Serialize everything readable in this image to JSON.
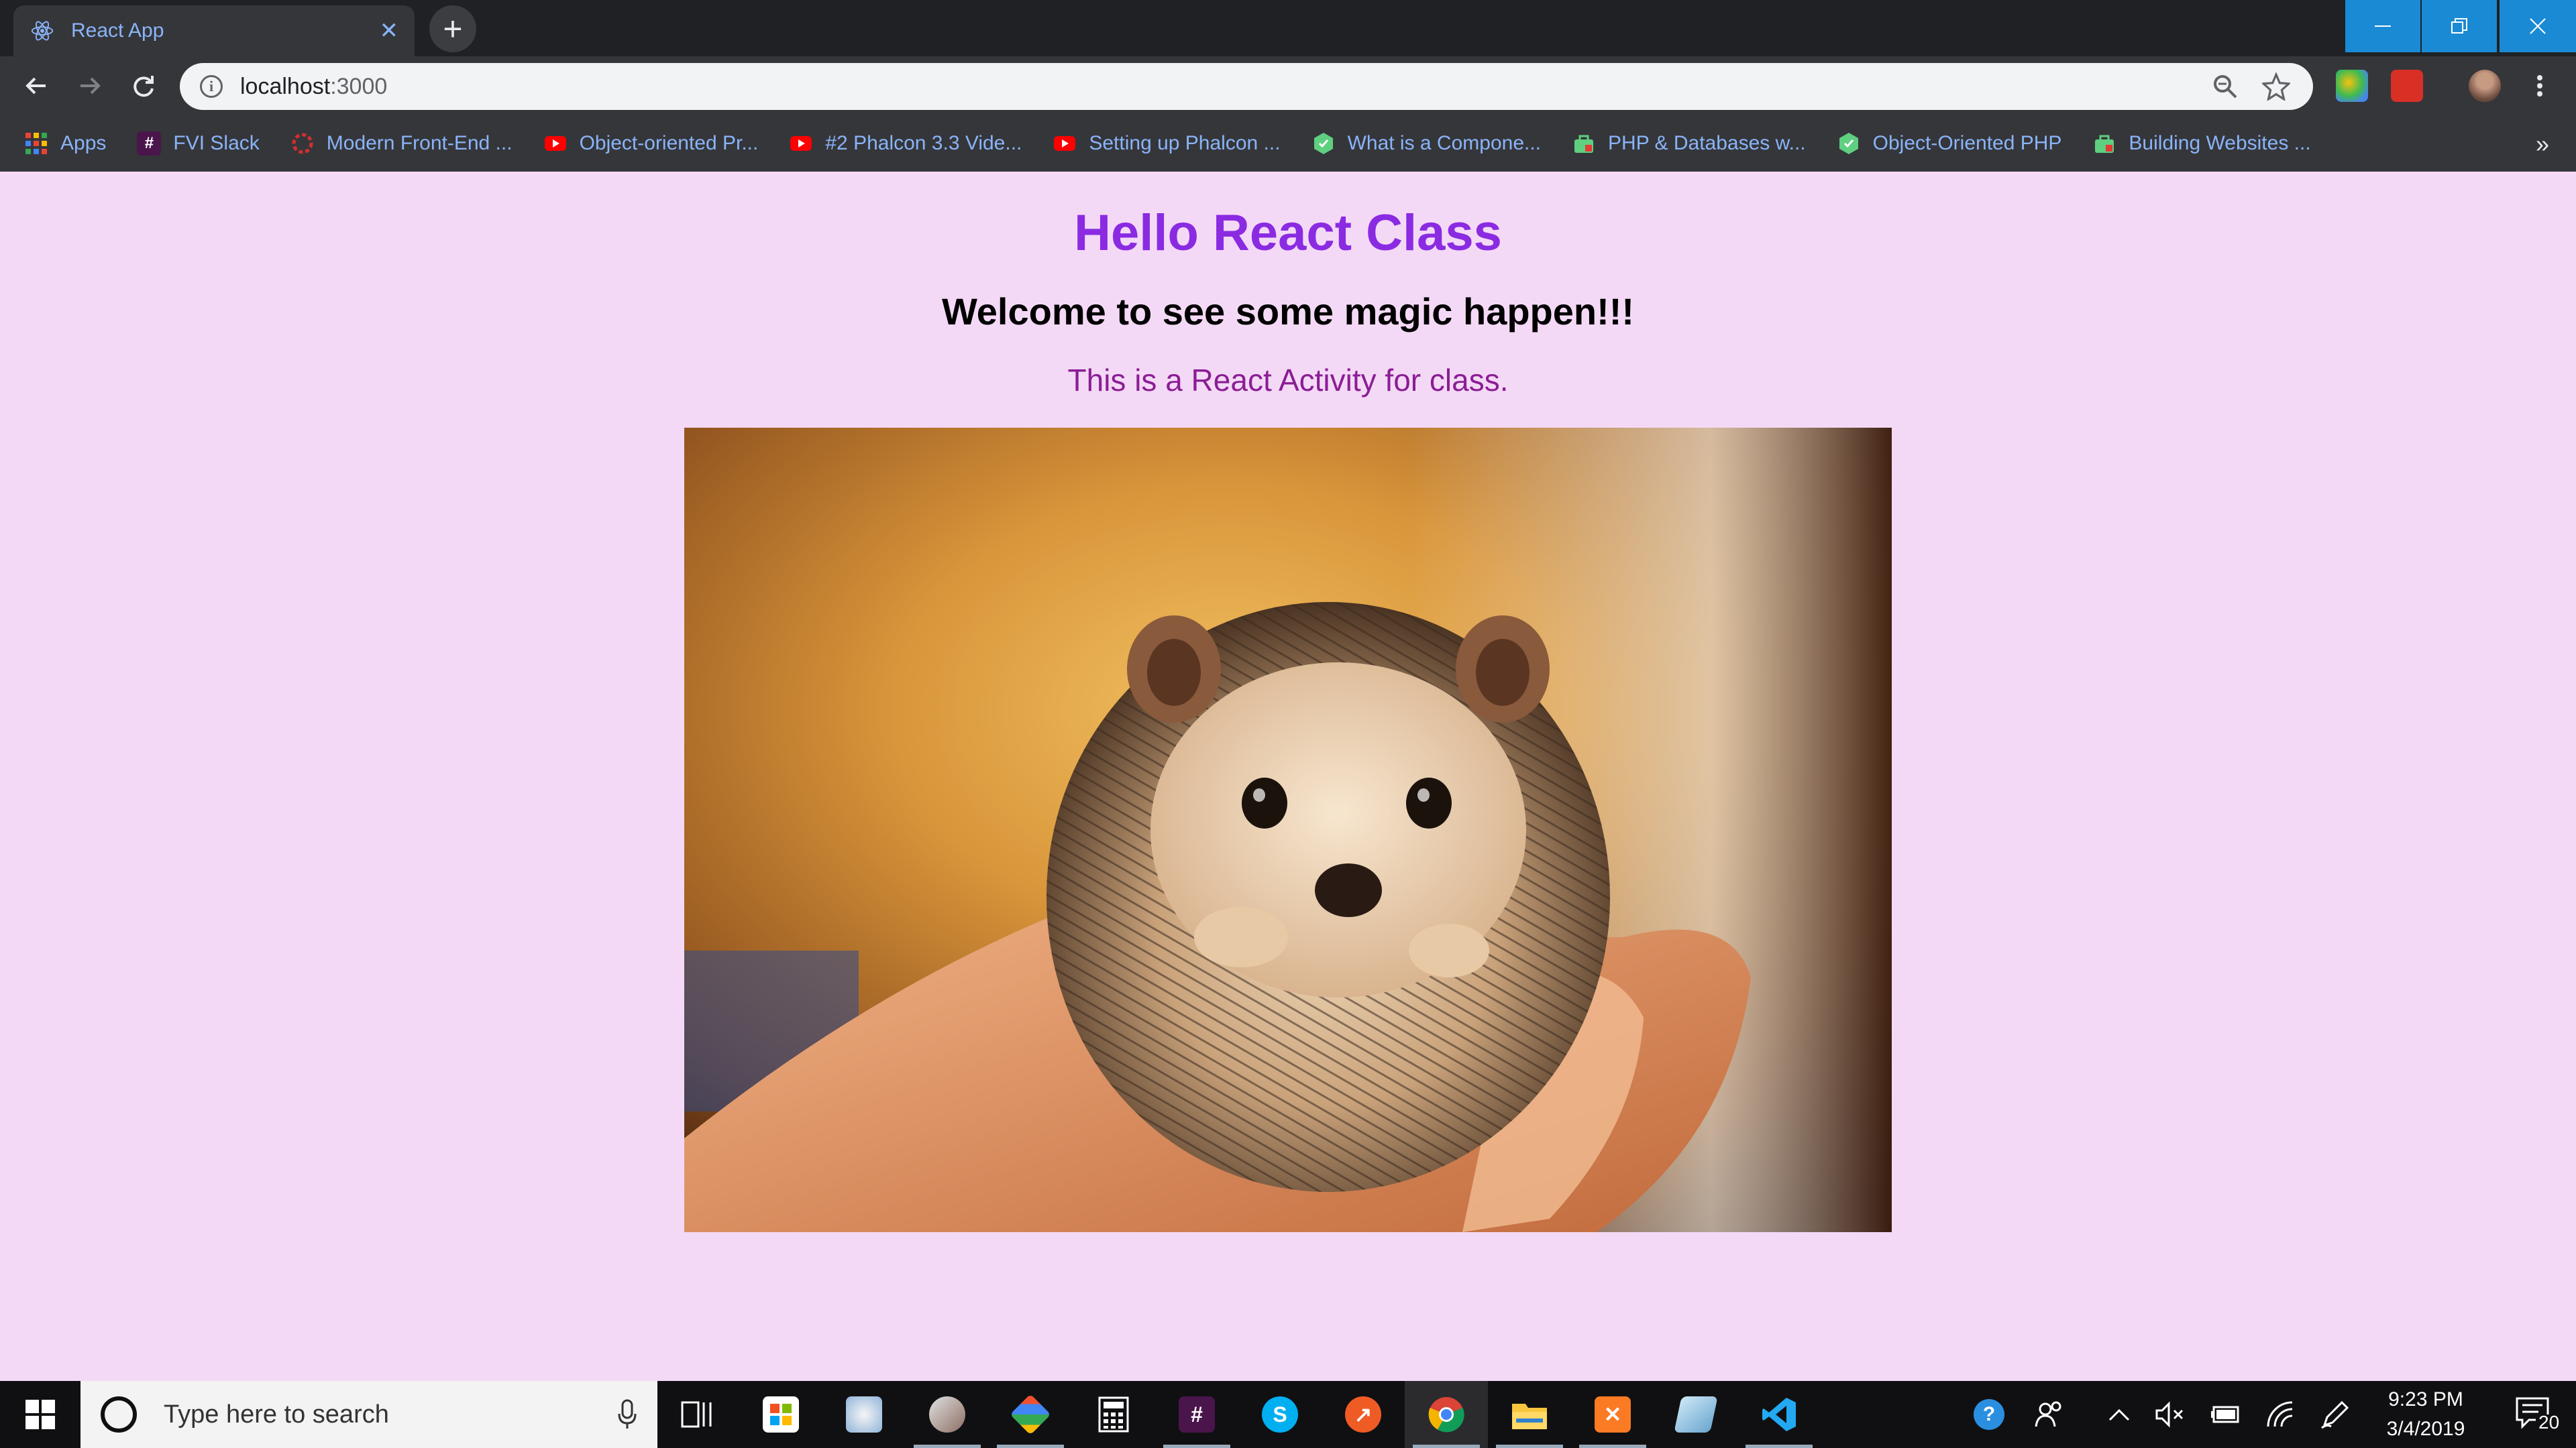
{
  "browser": {
    "tab": {
      "title": "React App",
      "favicon": "react-icon",
      "close_icon": "close-icon"
    },
    "new_tab_icon": "plus-icon",
    "window_controls": {
      "minimize": "minimize-icon",
      "restore": "restore-icon",
      "close": "close-icon"
    },
    "toolbar": {
      "back_icon": "arrow-left-icon",
      "forward_icon": "arrow-right-icon",
      "reload_icon": "reload-icon",
      "url_host": "localhost",
      "url_port": ":3000",
      "zoom_icon": "zoom-icon",
      "bookmark_icon": "star-icon",
      "menu_icon": "kebab-menu-icon"
    },
    "bookmarks": [
      {
        "label": "Apps",
        "icon": "apps-grid-icon",
        "color": "#e8453c"
      },
      {
        "label": "FVI Slack",
        "icon": "hash-icon",
        "color": "#4a154b"
      },
      {
        "label": "Modern Front-End ...",
        "icon": "gear-red-icon",
        "color": "#c62828"
      },
      {
        "label": "Object-oriented Pr...",
        "icon": "youtube-icon",
        "color": "#ff0000"
      },
      {
        "label": "#2 Phalcon 3.3 Vide...",
        "icon": "youtube-icon",
        "color": "#ff0000"
      },
      {
        "label": "Setting up Phalcon ...",
        "icon": "youtube-icon",
        "color": "#ff0000"
      },
      {
        "label": "What is a Compone...",
        "icon": "treehouse-icon",
        "color": "#5fcf80"
      },
      {
        "label": "PHP & Databases w...",
        "icon": "treehouse-bag-icon",
        "color": "#5fcf80"
      },
      {
        "label": "Object-Oriented PHP",
        "icon": "treehouse-icon",
        "color": "#5fcf80"
      },
      {
        "label": "Building Websites ...",
        "icon": "treehouse-bag-icon",
        "color": "#5fcf80"
      }
    ],
    "bookmarks_overflow": "»"
  },
  "page": {
    "heading": "Hello React Class",
    "subheading": "Welcome to see some magic happen!!!",
    "paragraph": "This is a React Activity for class.",
    "image": "hedgehog-photo",
    "colors": {
      "background": "#f4d9f6",
      "heading": "#8a2be2",
      "paragraph": "#8b1d95"
    }
  },
  "taskbar": {
    "search_placeholder": "Type here to search",
    "apps": [
      "task-view-icon",
      "store-icon",
      "paint-icon",
      "brush-icon",
      "git-icon",
      "calculator-icon",
      "slack-icon",
      "skype-icon",
      "postman-icon",
      "chrome-icon",
      "file-explorer-icon",
      "xampp-icon",
      "notepad-icon",
      "vscode-icon"
    ],
    "tray": [
      "help-icon",
      "people-icon",
      "chevron-up-icon",
      "mute-icon",
      "battery-icon",
      "wifi-icon",
      "pen-icon"
    ],
    "time": "9:23 PM",
    "date": "3/4/2019",
    "notification_count": "20"
  }
}
